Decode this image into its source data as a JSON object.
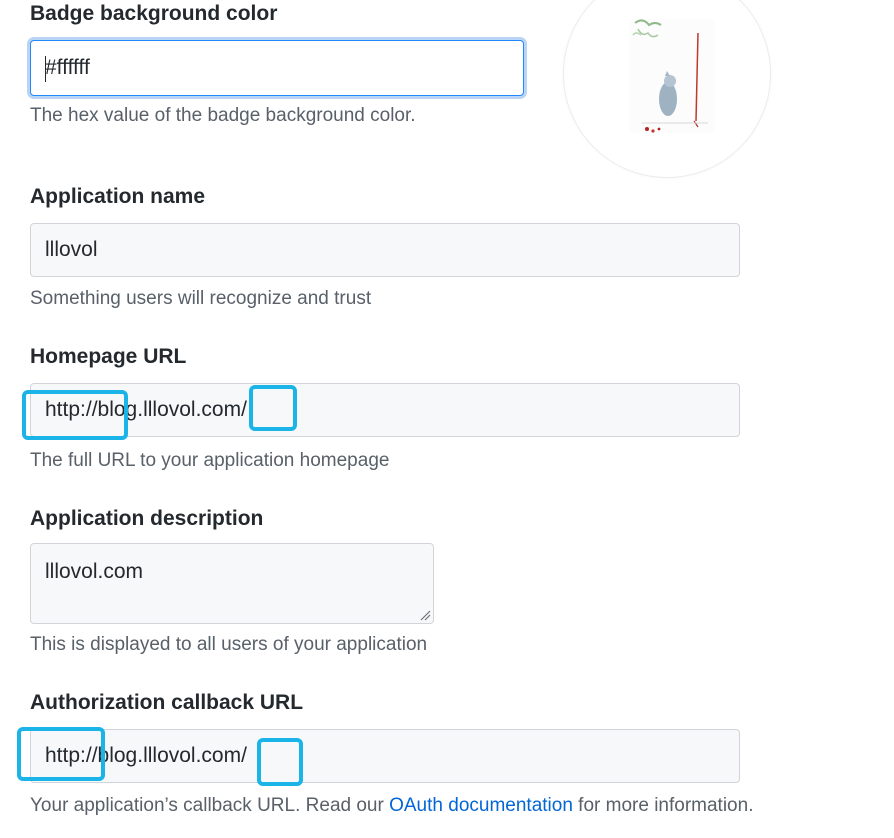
{
  "badge": {
    "label": "Badge background color",
    "value": "#ffffff",
    "note": "The hex value of the badge background color."
  },
  "app_name": {
    "label": "Application name",
    "value": "lllovol",
    "note": "Something users will recognize and trust"
  },
  "homepage": {
    "label": "Homepage URL",
    "value": "http://blog.lllovol.com/",
    "note": "The full URL to your application homepage"
  },
  "description": {
    "label": "Application description",
    "value": "lllovol.com",
    "note": "This is displayed to all users of your application"
  },
  "callback": {
    "label": "Authorization callback URL",
    "value": "http://blog.lllovol.com/",
    "note_before": "Your application’s callback URL. Read our ",
    "note_link": "OAuth documentation",
    "note_after": " for more information."
  },
  "colors": {
    "highlight": "#1ab4e8",
    "focus_border": "#2188ff",
    "link": "#0366d6"
  }
}
